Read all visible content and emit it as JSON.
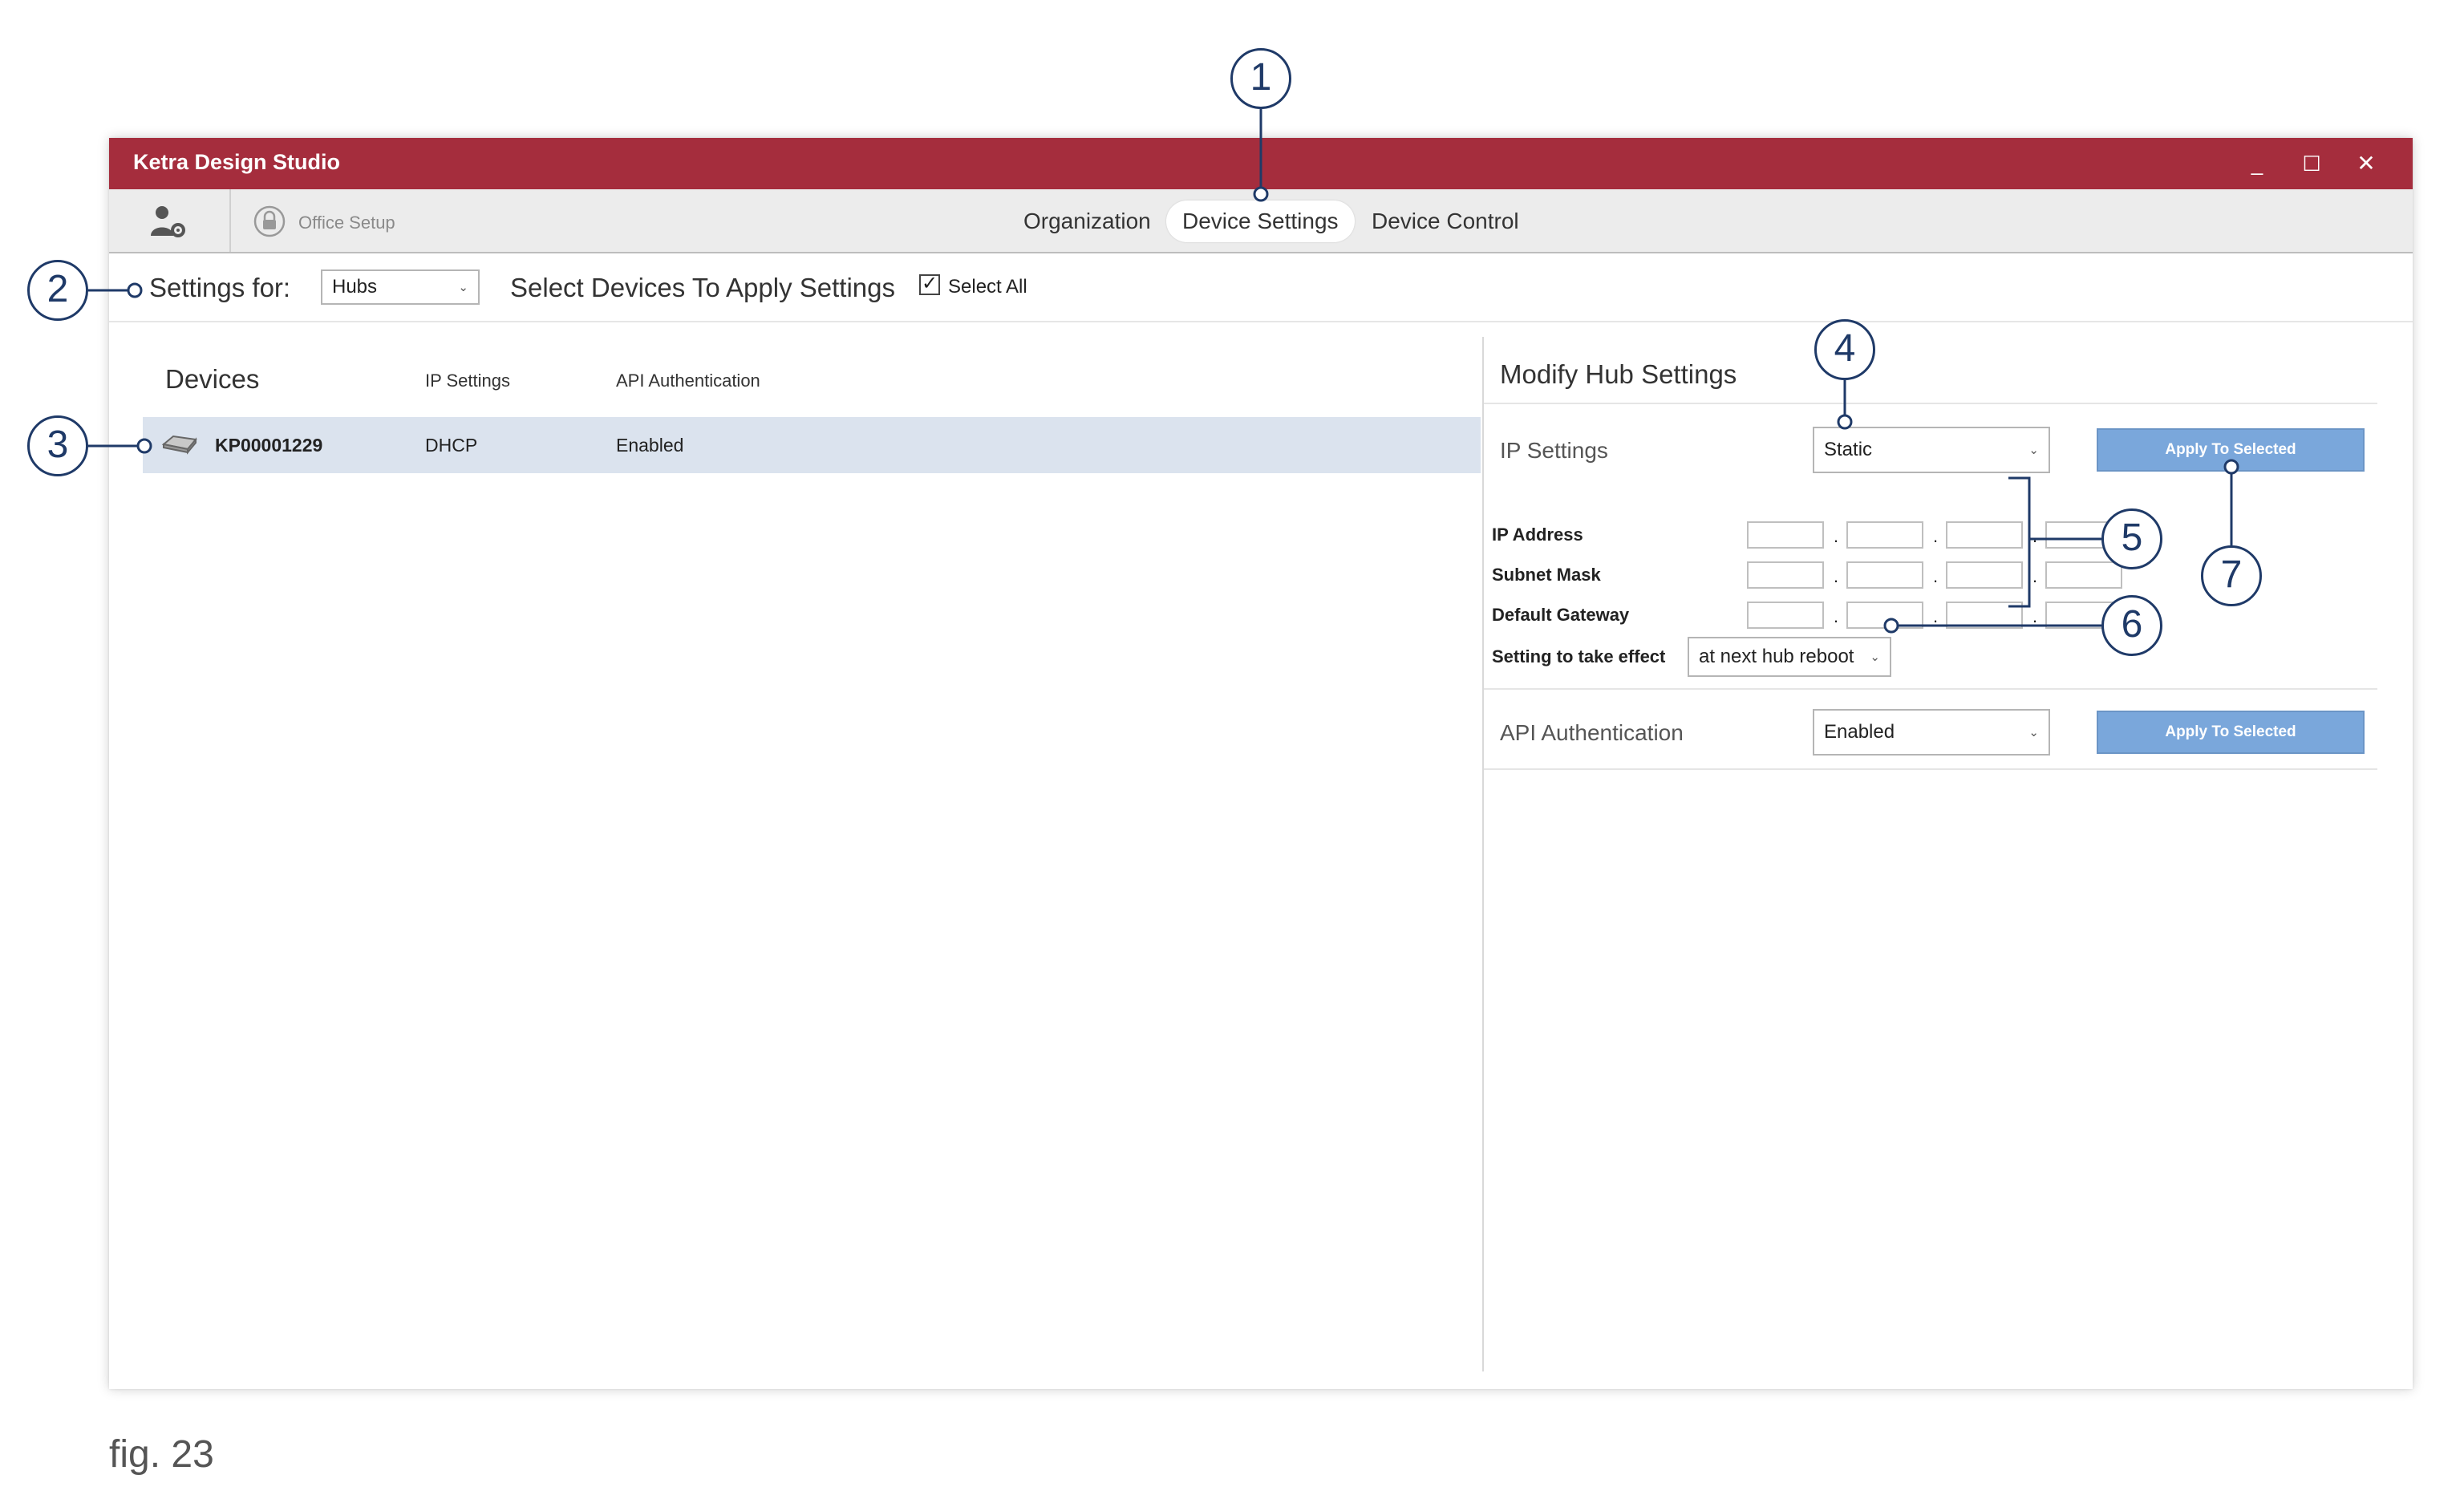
{
  "window": {
    "title": "Ketra Design Studio",
    "controls": {
      "minimize": "_",
      "maximize": "☐",
      "close": "✕"
    }
  },
  "nav": {
    "office_setup": "Office Setup",
    "tabs": [
      {
        "label": "Organization",
        "active": false
      },
      {
        "label": "Device Settings",
        "active": true
      },
      {
        "label": "Device Control",
        "active": false
      }
    ]
  },
  "toolbar": {
    "settings_for_label": "Settings for:",
    "settings_for_value": "Hubs",
    "select_devices_label": "Select Devices To Apply Settings",
    "select_all_label": "Select All",
    "select_all_checked": true
  },
  "devices": {
    "heading": "Devices",
    "columns": [
      "IP Settings",
      "API Authentication"
    ],
    "rows": [
      {
        "name": "KP00001229",
        "ip_settings": "DHCP",
        "api_auth": "Enabled",
        "selected": true
      }
    ]
  },
  "modify": {
    "title": "Modify Hub Settings",
    "ip_settings_label": "IP Settings",
    "ip_settings_value": "Static",
    "apply_label": "Apply To Selected",
    "fields": [
      {
        "label": "IP Address"
      },
      {
        "label": "Subnet Mask"
      },
      {
        "label": "Default Gateway"
      }
    ],
    "octet_separator": ".",
    "take_effect_label": "Setting to take effect",
    "take_effect_value": "at next hub reboot",
    "api_auth_label": "API Authentication",
    "api_auth_value": "Enabled"
  },
  "callouts": [
    "1",
    "2",
    "3",
    "4",
    "5",
    "6",
    "7"
  ],
  "caption": "fig. 23",
  "colors": {
    "titlebar": "#a52d3d",
    "selected_row": "#dbe3ee",
    "apply_button": "#7aa7db",
    "callout": "#1f3a68"
  }
}
